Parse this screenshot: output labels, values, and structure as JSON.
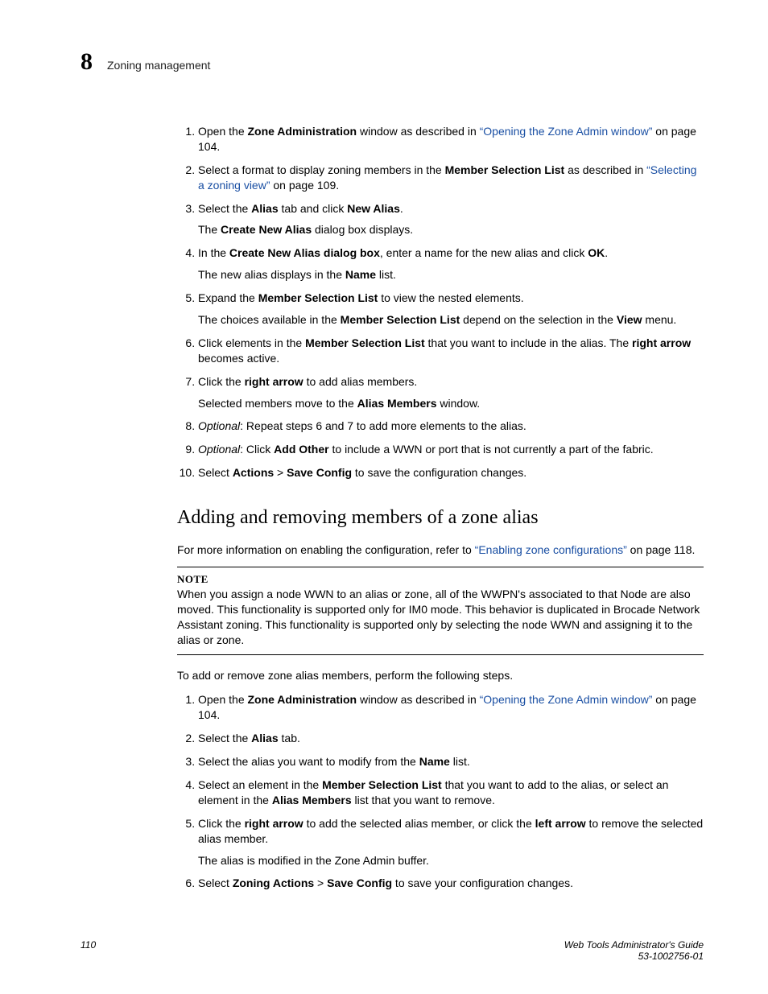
{
  "header": {
    "chapter_number": "8",
    "running_title": "Zoning management"
  },
  "steps_a": {
    "s1_pre": "Open the ",
    "s1_b1": "Zone Administration",
    "s1_mid": " window as described in ",
    "s1_link": "“Opening the Zone Admin window”",
    "s1_post": " on page 104.",
    "s2_pre": "Select a format to display zoning members in the ",
    "s2_b1": "Member Selection List",
    "s2_mid": " as described in ",
    "s2_link": "“Selecting a zoning view”",
    "s2_post": " on page 109.",
    "s3_pre": "Select the ",
    "s3_b1": "Alias",
    "s3_mid": " tab and click ",
    "s3_b2": "New Alias",
    "s3_post": ".",
    "s3_sub_pre": "The ",
    "s3_sub_b": "Create New Alias",
    "s3_sub_post": " dialog box displays.",
    "s4_pre": "In the ",
    "s4_b1": "Create New Alias dialog box",
    "s4_mid": ", enter a name for the new alias and click ",
    "s4_b2": "OK",
    "s4_post": ".",
    "s4_sub_pre": "The new alias displays in the ",
    "s4_sub_b": "Name",
    "s4_sub_post": " list.",
    "s5_pre": "Expand the ",
    "s5_b1": "Member Selection List",
    "s5_post": " to view the nested elements.",
    "s5_sub_pre": "The choices available in the ",
    "s5_sub_b1": "Member Selection List",
    "s5_sub_mid": " depend on the selection in the ",
    "s5_sub_b2": "View",
    "s5_sub_post": " menu.",
    "s6_pre": "Click elements in the ",
    "s6_b1": "Member Selection List",
    "s6_mid": " that you want to include in the alias. The ",
    "s6_b2": "right arrow",
    "s6_post": " becomes active.",
    "s7_pre": "Click the ",
    "s7_b1": "right arrow",
    "s7_post": " to add alias members.",
    "s7_sub_pre": "Selected members move to the ",
    "s7_sub_b": "Alias Members",
    "s7_sub_post": " window.",
    "s8_i": "Optional",
    "s8_post": ": Repeat steps 6 and 7 to add more elements to the alias.",
    "s9_i": "Optional",
    "s9_mid": ": Click ",
    "s9_b1": "Add Other",
    "s9_post": " to include a WWN or port that is not currently a part of the fabric.",
    "s10_pre": "Select ",
    "s10_b1": "Actions",
    "s10_mid": " > ",
    "s10_b2": "Save Config",
    "s10_post": " to save the configuration changes."
  },
  "section": {
    "title": "Adding and removing members of a zone alias",
    "intro_pre": "For more information on enabling the configuration, refer to ",
    "intro_link": "“Enabling zone configurations”",
    "intro_post": " on page 118.",
    "note_label": "NOTE",
    "note_body": "When you assign a node WWN to an alias or zone, all of the WWPN's associated to that Node are also moved. This functionality is supported only for IM0 mode. This behavior is duplicated in Brocade Network Assistant zoning. This functionality is supported only by selecting the node WWN and assigning it to the alias or zone.",
    "lead": "To add or remove zone alias members, perform the following steps."
  },
  "steps_b": {
    "s1_pre": "Open the ",
    "s1_b1": "Zone Administration",
    "s1_mid": " window as described in ",
    "s1_link": "“Opening the Zone Admin window”",
    "s1_post": " on page 104.",
    "s2_pre": "Select the ",
    "s2_b1": "Alias",
    "s2_post": " tab.",
    "s3_pre": "Select the alias you want to modify from the ",
    "s3_b1": "Name",
    "s3_post": " list.",
    "s4_pre": "Select an element in the ",
    "s4_b1": "Member Selection List",
    "s4_mid": " that you want to add to the alias, or select an element in the ",
    "s4_b2": "Alias Members",
    "s4_post": " list that you want to remove.",
    "s5_pre": "Click the ",
    "s5_b1": "right arrow",
    "s5_mid": " to add the selected alias member, or click the ",
    "s5_b2": "left arrow",
    "s5_post": " to remove the selected alias member.",
    "s5_sub": "The alias is modified in the Zone Admin buffer.",
    "s6_pre": "Select ",
    "s6_b1": "Zoning Actions",
    "s6_mid": " > ",
    "s6_b2": "Save Config",
    "s6_post": " to save your configuration changes."
  },
  "footer": {
    "page_number": "110",
    "doc_title": "Web Tools Administrator's Guide",
    "doc_id": "53-1002756-01"
  }
}
